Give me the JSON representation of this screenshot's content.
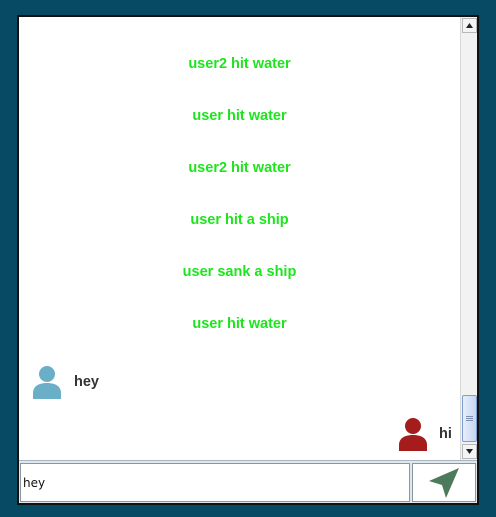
{
  "chat": {
    "events": [
      {
        "text": "user2 hit water"
      },
      {
        "text": "user hit water"
      },
      {
        "text": "user2 hit water"
      },
      {
        "text": "user hit a ship"
      },
      {
        "text": "user sank a ship"
      },
      {
        "text": "user hit water"
      }
    ],
    "messages": [
      {
        "sender": "other",
        "text": "hey",
        "avatar_color": "#6aafc7"
      },
      {
        "sender": "self",
        "text": "hi",
        "avatar_color": "#a41c1c"
      }
    ],
    "event_color": "#1de51d"
  },
  "composer": {
    "input_value": "hey",
    "send_icon": "send-icon",
    "send_icon_color": "#4d7a5a"
  },
  "scrollbar": {
    "position_fraction": 0.97
  }
}
